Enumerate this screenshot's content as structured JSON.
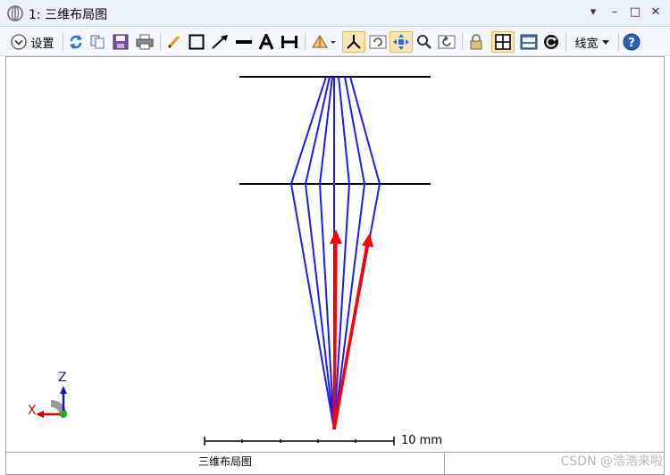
{
  "window": {
    "title": "1: 三维布局图",
    "controls": [
      "▾",
      "–",
      "□",
      "✕"
    ]
  },
  "toolbar": {
    "settings_label": "设置",
    "linewidth_label": "线宽"
  },
  "scalebar": {
    "label": "10 mm"
  },
  "axes_triad": {
    "z_label": "Z",
    "x_label": "X"
  },
  "footer": {
    "caption": "三维布局图"
  },
  "watermark": "CSDN @浩浩来啦",
  "colors": {
    "rays": "#1a1aff",
    "arrows": "#ff0000",
    "surfaces": "#000000",
    "toolbar_bg": "#f3f6fb",
    "title_bg": "#eaf1fb",
    "active_tool": "#fce6b4"
  }
}
